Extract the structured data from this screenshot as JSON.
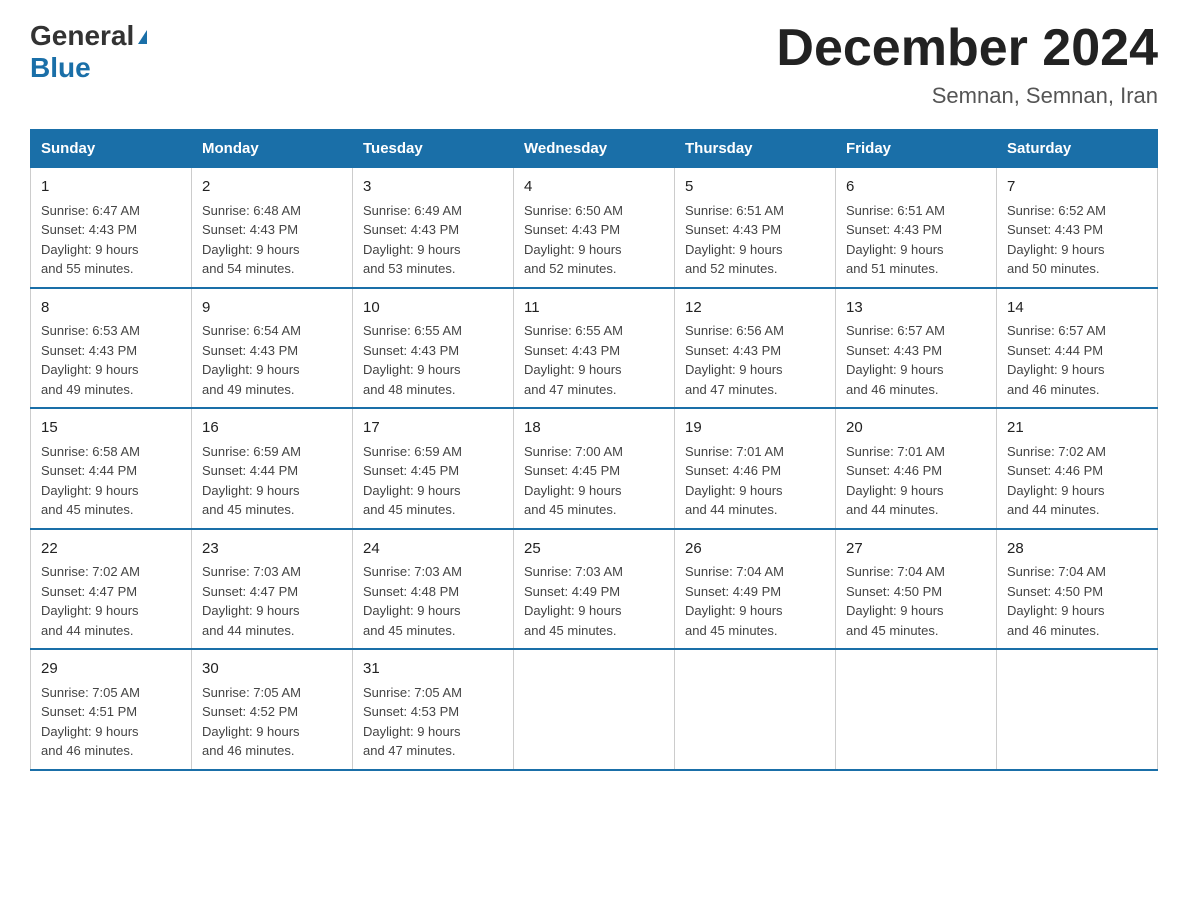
{
  "logo": {
    "general": "General",
    "blue": "Blue",
    "triangle": "▶"
  },
  "title": "December 2024",
  "subtitle": "Semnan, Semnan, Iran",
  "days_of_week": [
    "Sunday",
    "Monday",
    "Tuesday",
    "Wednesday",
    "Thursday",
    "Friday",
    "Saturday"
  ],
  "weeks": [
    [
      {
        "day": "1",
        "sunrise": "6:47 AM",
        "sunset": "4:43 PM",
        "daylight": "9 hours and 55 minutes."
      },
      {
        "day": "2",
        "sunrise": "6:48 AM",
        "sunset": "4:43 PM",
        "daylight": "9 hours and 54 minutes."
      },
      {
        "day": "3",
        "sunrise": "6:49 AM",
        "sunset": "4:43 PM",
        "daylight": "9 hours and 53 minutes."
      },
      {
        "day": "4",
        "sunrise": "6:50 AM",
        "sunset": "4:43 PM",
        "daylight": "9 hours and 52 minutes."
      },
      {
        "day": "5",
        "sunrise": "6:51 AM",
        "sunset": "4:43 PM",
        "daylight": "9 hours and 52 minutes."
      },
      {
        "day": "6",
        "sunrise": "6:51 AM",
        "sunset": "4:43 PM",
        "daylight": "9 hours and 51 minutes."
      },
      {
        "day": "7",
        "sunrise": "6:52 AM",
        "sunset": "4:43 PM",
        "daylight": "9 hours and 50 minutes."
      }
    ],
    [
      {
        "day": "8",
        "sunrise": "6:53 AM",
        "sunset": "4:43 PM",
        "daylight": "9 hours and 49 minutes."
      },
      {
        "day": "9",
        "sunrise": "6:54 AM",
        "sunset": "4:43 PM",
        "daylight": "9 hours and 49 minutes."
      },
      {
        "day": "10",
        "sunrise": "6:55 AM",
        "sunset": "4:43 PM",
        "daylight": "9 hours and 48 minutes."
      },
      {
        "day": "11",
        "sunrise": "6:55 AM",
        "sunset": "4:43 PM",
        "daylight": "9 hours and 47 minutes."
      },
      {
        "day": "12",
        "sunrise": "6:56 AM",
        "sunset": "4:43 PM",
        "daylight": "9 hours and 47 minutes."
      },
      {
        "day": "13",
        "sunrise": "6:57 AM",
        "sunset": "4:43 PM",
        "daylight": "9 hours and 46 minutes."
      },
      {
        "day": "14",
        "sunrise": "6:57 AM",
        "sunset": "4:44 PM",
        "daylight": "9 hours and 46 minutes."
      }
    ],
    [
      {
        "day": "15",
        "sunrise": "6:58 AM",
        "sunset": "4:44 PM",
        "daylight": "9 hours and 45 minutes."
      },
      {
        "day": "16",
        "sunrise": "6:59 AM",
        "sunset": "4:44 PM",
        "daylight": "9 hours and 45 minutes."
      },
      {
        "day": "17",
        "sunrise": "6:59 AM",
        "sunset": "4:45 PM",
        "daylight": "9 hours and 45 minutes."
      },
      {
        "day": "18",
        "sunrise": "7:00 AM",
        "sunset": "4:45 PM",
        "daylight": "9 hours and 45 minutes."
      },
      {
        "day": "19",
        "sunrise": "7:01 AM",
        "sunset": "4:46 PM",
        "daylight": "9 hours and 44 minutes."
      },
      {
        "day": "20",
        "sunrise": "7:01 AM",
        "sunset": "4:46 PM",
        "daylight": "9 hours and 44 minutes."
      },
      {
        "day": "21",
        "sunrise": "7:02 AM",
        "sunset": "4:46 PM",
        "daylight": "9 hours and 44 minutes."
      }
    ],
    [
      {
        "day": "22",
        "sunrise": "7:02 AM",
        "sunset": "4:47 PM",
        "daylight": "9 hours and 44 minutes."
      },
      {
        "day": "23",
        "sunrise": "7:03 AM",
        "sunset": "4:47 PM",
        "daylight": "9 hours and 44 minutes."
      },
      {
        "day": "24",
        "sunrise": "7:03 AM",
        "sunset": "4:48 PM",
        "daylight": "9 hours and 45 minutes."
      },
      {
        "day": "25",
        "sunrise": "7:03 AM",
        "sunset": "4:49 PM",
        "daylight": "9 hours and 45 minutes."
      },
      {
        "day": "26",
        "sunrise": "7:04 AM",
        "sunset": "4:49 PM",
        "daylight": "9 hours and 45 minutes."
      },
      {
        "day": "27",
        "sunrise": "7:04 AM",
        "sunset": "4:50 PM",
        "daylight": "9 hours and 45 minutes."
      },
      {
        "day": "28",
        "sunrise": "7:04 AM",
        "sunset": "4:50 PM",
        "daylight": "9 hours and 46 minutes."
      }
    ],
    [
      {
        "day": "29",
        "sunrise": "7:05 AM",
        "sunset": "4:51 PM",
        "daylight": "9 hours and 46 minutes."
      },
      {
        "day": "30",
        "sunrise": "7:05 AM",
        "sunset": "4:52 PM",
        "daylight": "9 hours and 46 minutes."
      },
      {
        "day": "31",
        "sunrise": "7:05 AM",
        "sunset": "4:53 PM",
        "daylight": "9 hours and 47 minutes."
      },
      null,
      null,
      null,
      null
    ]
  ],
  "labels": {
    "sunrise": "Sunrise:",
    "sunset": "Sunset:",
    "daylight": "Daylight:"
  }
}
